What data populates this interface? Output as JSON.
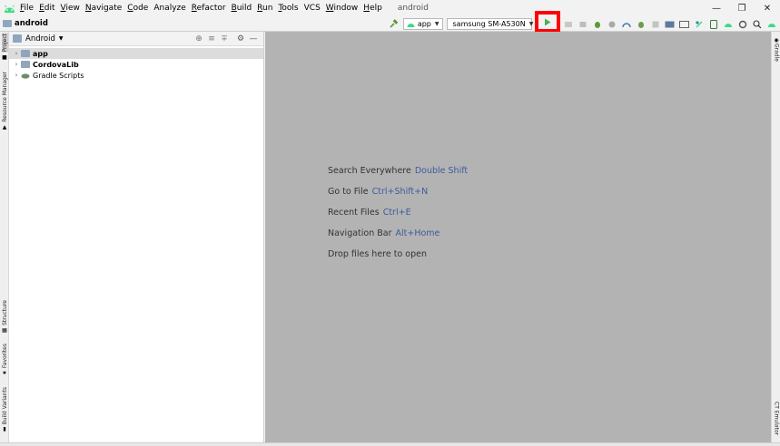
{
  "menu": {
    "items": [
      {
        "mnemonic": "F",
        "rest": "ile"
      },
      {
        "mnemonic": "E",
        "rest": "dit"
      },
      {
        "mnemonic": "V",
        "rest": "iew"
      },
      {
        "mnemonic": "N",
        "rest": "avigate"
      },
      {
        "mnemonic": "C",
        "rest": "ode"
      },
      {
        "mnemonic": "",
        "rest": "Analyze"
      },
      {
        "mnemonic": "R",
        "rest": "efactor"
      },
      {
        "mnemonic": "B",
        "rest": "uild"
      },
      {
        "mnemonic": "R",
        "rest": "un"
      },
      {
        "mnemonic": "T",
        "rest": "ools"
      },
      {
        "mnemonic": "",
        "rest": "VCS"
      },
      {
        "mnemonic": "W",
        "rest": "indow"
      },
      {
        "mnemonic": "H",
        "rest": "elp"
      }
    ],
    "window_title": "android"
  },
  "navbar": {
    "breadcrumb": "android",
    "run_config": "app",
    "device": "samsung SM-A530N"
  },
  "project_panel": {
    "view_mode": "Android",
    "tree": [
      {
        "label": "app",
        "bold": true,
        "selected": true
      },
      {
        "label": "CordovaLib",
        "bold": true,
        "selected": false
      },
      {
        "label": "Gradle Scripts",
        "bold": false,
        "selected": false
      }
    ]
  },
  "editor": {
    "hints": [
      {
        "text": "Search Everywhere",
        "key": "Double Shift"
      },
      {
        "text": "Go to File",
        "key": "Ctrl+Shift+N"
      },
      {
        "text": "Recent Files",
        "key": "Ctrl+E"
      },
      {
        "text": "Navigation Bar",
        "key": "Alt+Home"
      },
      {
        "text": "Drop files here to open",
        "key": ""
      }
    ]
  },
  "left_tabs": {
    "project": "Project",
    "resource_manager": "Resource Manager",
    "structure": "Structure",
    "favorites": "Favorites",
    "build_variants": "Build Variants"
  },
  "right_tabs": {
    "gradle": "Gradle",
    "emulator": "CT Emulator"
  },
  "colors": {
    "editor_bg": "#b3b3b3",
    "shortcut": "#3d5b9e",
    "highlight_box": "#ff0000",
    "run_green": "#4caf50"
  }
}
